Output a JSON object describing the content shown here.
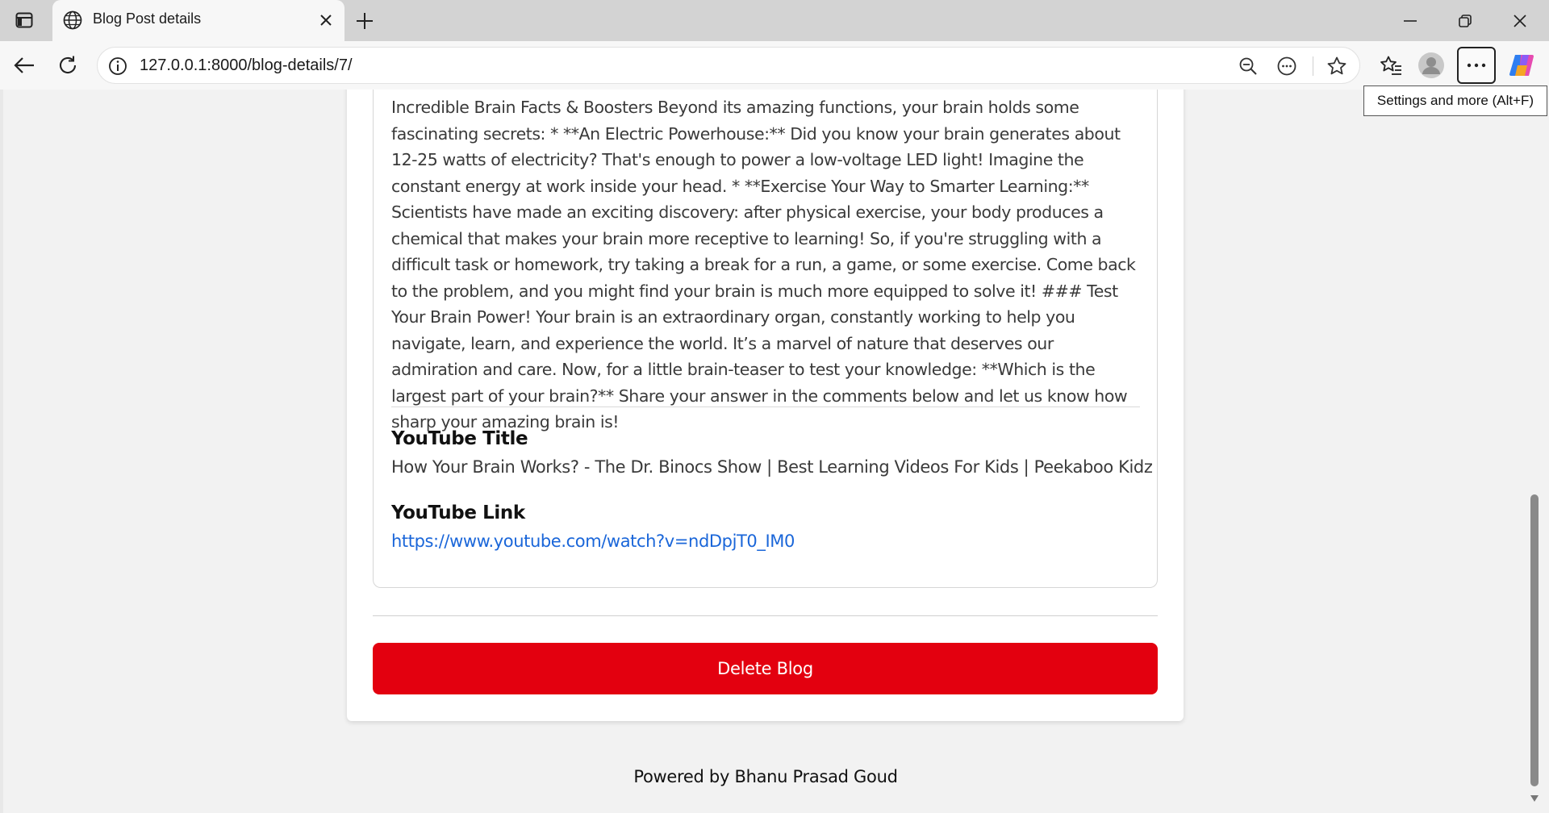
{
  "browser": {
    "tab_title": "Blog Post details",
    "url": "127.0.0.1:8000/blog-details/7/",
    "tooltip": "Settings and more (Alt+F)",
    "icons": [
      "tab-panel-icon",
      "globe-icon",
      "close-icon",
      "plus-icon",
      "minimize-icon",
      "restore-icon",
      "close-window-icon",
      "back-icon",
      "refresh-icon",
      "info-icon",
      "zoom-out-icon",
      "reader-icon",
      "star-icon",
      "favorites-icon",
      "profile-icon",
      "more-icon",
      "copilot-icon"
    ]
  },
  "post": {
    "content": "Incredible Brain Facts & Boosters Beyond its amazing functions, your brain holds some fascinating secrets: * **An Electric Powerhouse:** Did you know your brain generates about 12-25 watts of electricity? That's enough to power a low-voltage LED light! Imagine the constant energy at work inside your head. * **Exercise Your Way to Smarter Learning:** Scientists have made an exciting discovery: after physical exercise, your body produces a chemical that makes your brain more receptive to learning! So, if you're struggling with a difficult task or homework, try taking a break for a run, a game, or some exercise. Come back to the problem, and you might find your brain is much more equipped to solve it! ### Test Your Brain Power! Your brain is an extraordinary organ, constantly working to help you navigate, learn, and experience the world. It’s a marvel of nature that deserves our admiration and care. Now, for a little brain-teaser to test your knowledge: **Which is the largest part of your brain?** Share your answer in the comments below and let us know how sharp your amazing brain is!",
    "youtube_title_label": "YouTube Title",
    "youtube_title": "How Your Brain Works? - The Dr. Binocs Show | Best Learning Videos For Kids | Peekaboo Kidz",
    "youtube_link_label": "YouTube Link",
    "youtube_link": "https://www.youtube.com/watch?v=ndDpjT0_IM0"
  },
  "actions": {
    "delete_label": "Delete Blog"
  },
  "footer": {
    "text": "Powered by Bhanu Prasad Goud"
  },
  "colors": {
    "delete": "#e3000f",
    "link": "#1a66d9"
  }
}
